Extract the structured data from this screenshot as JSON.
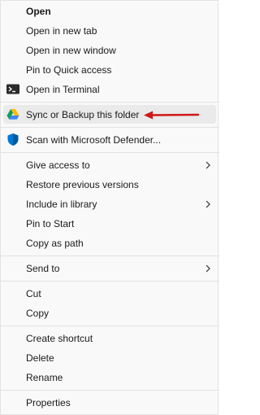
{
  "menu": {
    "open": "Open",
    "open_new_tab": "Open in new tab",
    "open_new_window": "Open in new window",
    "pin_quick_access": "Pin to Quick access",
    "open_terminal": "Open in Terminal",
    "sync_backup": "Sync or Backup this folder",
    "scan_defender": "Scan with Microsoft Defender...",
    "give_access": "Give access to",
    "restore_versions": "Restore previous versions",
    "include_library": "Include in library",
    "pin_start": "Pin to Start",
    "copy_path": "Copy as path",
    "send_to": "Send to",
    "cut": "Cut",
    "copy": "Copy",
    "create_shortcut": "Create shortcut",
    "delete": "Delete",
    "rename": "Rename",
    "properties": "Properties"
  },
  "icons": {
    "terminal": "terminal-icon",
    "drive": "google-drive-icon",
    "defender": "defender-shield-icon",
    "submenu": "chevron-right-icon",
    "annotation": "red-arrow-icon"
  },
  "colors": {
    "hover_bg": "#eaeaea",
    "annotation_arrow": "#d01818",
    "defender_blue": "#0078d4"
  }
}
